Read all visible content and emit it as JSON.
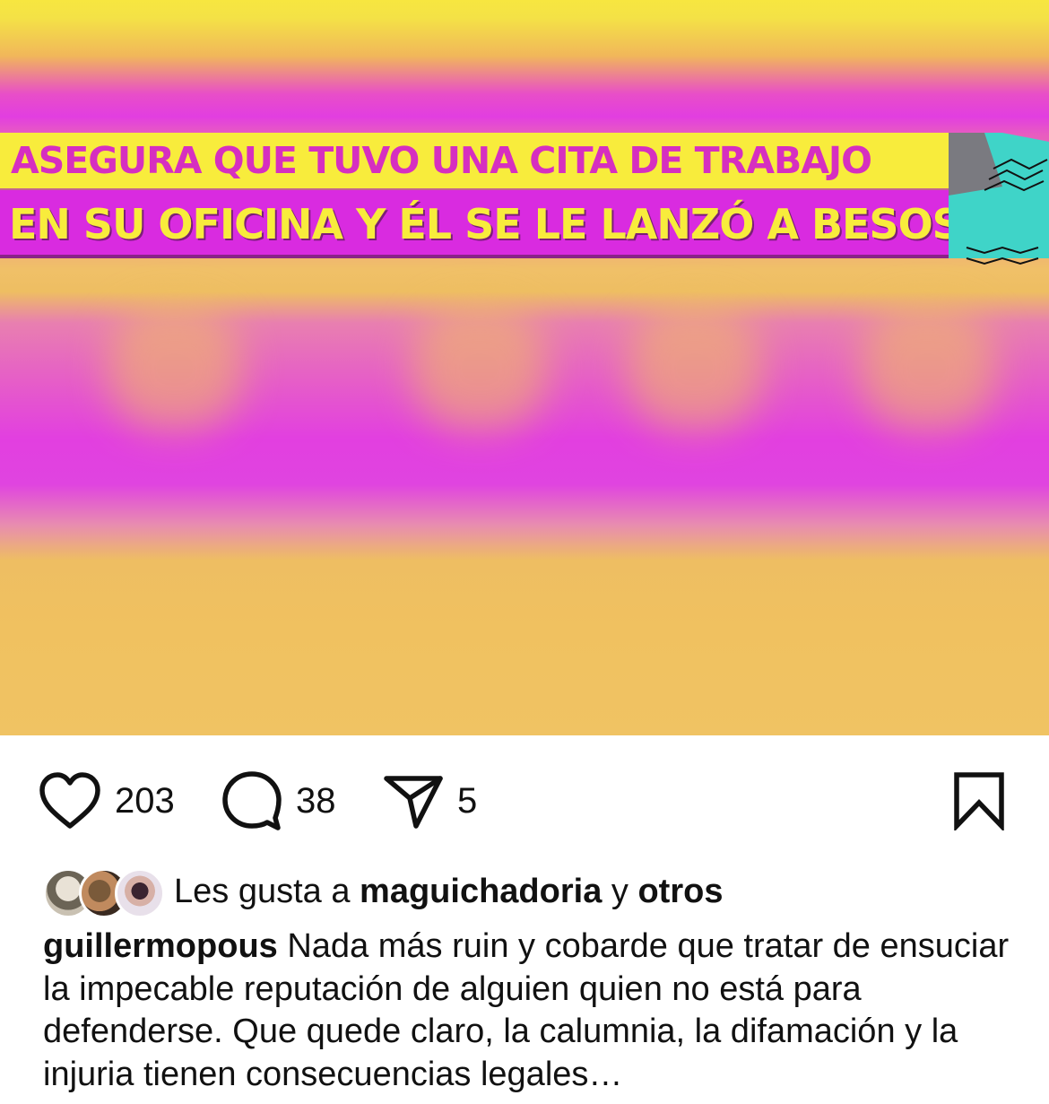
{
  "media": {
    "banner_line1": "ASEGURA QUE TUVO UNA CITA DE TRABAJO",
    "banner_line2": "EN SU OFICINA Y ÉL SE LE LANZÓ A BESOS",
    "colors": {
      "banner_yellow": "#f8ec3c",
      "banner_magenta": "#d92be0",
      "background_magenta": "#e23ee0",
      "background_orange": "#f0c363"
    }
  },
  "actions": {
    "like_icon": "heart-outline-icon",
    "likes_count": "203",
    "comment_icon": "speech-bubble-icon",
    "comments_count": "38",
    "share_icon": "paper-plane-icon",
    "shares_count": "5",
    "save_icon": "bookmark-icon"
  },
  "liked_by": {
    "prefix": "Les gusta a",
    "user": "maguichadoria",
    "connector": "y",
    "others": "otros"
  },
  "caption": {
    "username": "guillermopous",
    "text": "Nada más ruin y cobarde que tratar de ensuciar la impecable reputación de alguien quien no está para defenderse. Que quede claro, la calumnia, la difamación y la injuria tienen consecuencias legales…"
  }
}
